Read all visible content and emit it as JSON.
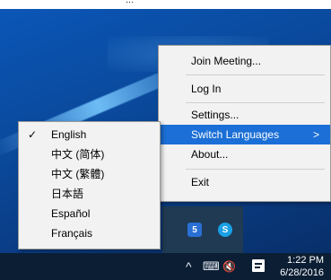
{
  "top_bar": {
    "partial_text": "..."
  },
  "context_menu": {
    "items": [
      {
        "label": "Join Meeting...",
        "has_submenu": false,
        "highlighted": false
      },
      {
        "label": "Log In",
        "has_submenu": false,
        "highlighted": false
      },
      {
        "label": "Settings...",
        "has_submenu": false,
        "highlighted": false
      },
      {
        "label": "Switch Languages",
        "has_submenu": true,
        "highlighted": true,
        "submenu_arrow": ">"
      },
      {
        "label": "About...",
        "has_submenu": false,
        "highlighted": false
      },
      {
        "label": "Exit",
        "has_submenu": false,
        "highlighted": false
      }
    ]
  },
  "languages_submenu": {
    "items": [
      {
        "label": "English",
        "checked": true
      },
      {
        "label": "中文 (简体)",
        "checked": false
      },
      {
        "label": "中文 (繁體)",
        "checked": false
      },
      {
        "label": "日本語",
        "checked": false
      },
      {
        "label": "Español",
        "checked": false
      },
      {
        "label": "Français",
        "checked": false
      }
    ],
    "check_glyph": "✓"
  },
  "tray_flyout": {
    "icons": [
      {
        "name": "webex-tray-icon",
        "glyph": "5",
        "color": "#2a6fd4"
      },
      {
        "name": "skype-tray-icon",
        "glyph": "S",
        "color": "#1aa0e6"
      }
    ]
  },
  "taskbar": {
    "chevron_glyph": "^",
    "network_glyph": "⌨",
    "volume_glyph": "🔇",
    "clock_time": "1:22 PM",
    "clock_date": "6/28/2016"
  },
  "colors": {
    "menu_highlight": "#1b6fd6",
    "menu_background": "#f2f2f2",
    "taskbar_background": "#0b1e33",
    "desktop_background": "#0a4a9e"
  }
}
